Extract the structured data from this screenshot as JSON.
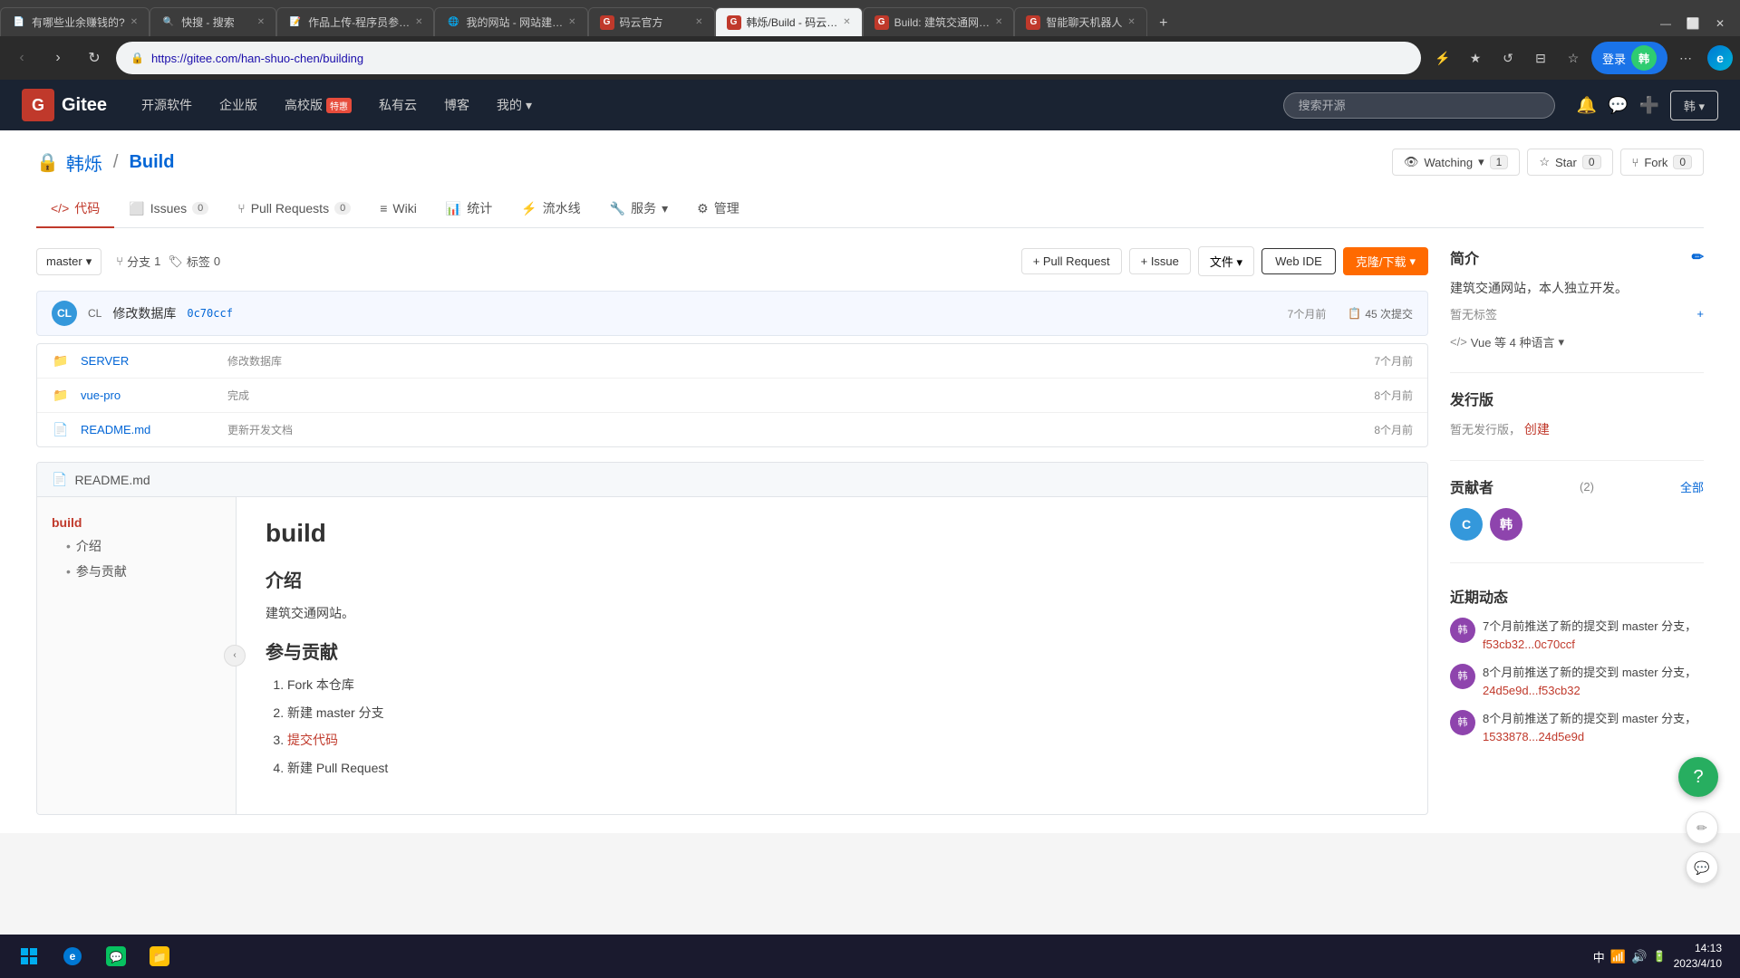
{
  "browser": {
    "address": "https://gitee.com/han-shuo-chen/building",
    "tabs": [
      {
        "id": "tab1",
        "title": "有哪些业余赚钱的?",
        "favicon": "📄",
        "active": false
      },
      {
        "id": "tab2",
        "title": "快搜 - 搜索",
        "favicon": "🔍",
        "active": false
      },
      {
        "id": "tab3",
        "title": "作品上传-程序员参…",
        "favicon": "📝",
        "active": false
      },
      {
        "id": "tab4",
        "title": "我的网站 - 网站建…",
        "favicon": "🌐",
        "active": false
      },
      {
        "id": "tab5",
        "title": "码云官方",
        "favicon": "G",
        "active": false
      },
      {
        "id": "tab6",
        "title": "韩烁/Build - 码云…",
        "favicon": "G",
        "active": true
      },
      {
        "id": "tab7",
        "title": "Build: 建筑交通网…",
        "favicon": "G",
        "active": false
      },
      {
        "id": "tab8",
        "title": "智能聊天机器人",
        "favicon": "G",
        "active": false
      }
    ]
  },
  "gitee": {
    "nav": {
      "logo_text": "Gitee",
      "items": [
        "开源软件",
        "企业版",
        "高校版",
        "私有云",
        "博客",
        "我的"
      ],
      "enterprise_badge": "特惠",
      "search_placeholder": "搜索开源"
    },
    "repo": {
      "owner": "韩烁",
      "slash": "/",
      "name": "Build",
      "lock_icon": "🔒",
      "watching_label": "Watching",
      "watching_count": "1",
      "star_label": "Star",
      "star_count": "0",
      "fork_label": "Fork",
      "fork_count": "0"
    },
    "tabs": [
      {
        "label": "代码",
        "icon": "</>",
        "active": true,
        "badge": ""
      },
      {
        "label": "Issues",
        "icon": "⬜",
        "active": false,
        "badge": "0"
      },
      {
        "label": "Pull Requests",
        "icon": "⑂",
        "active": false,
        "badge": "0"
      },
      {
        "label": "Wiki",
        "icon": "≡",
        "active": false,
        "badge": ""
      },
      {
        "label": "统计",
        "icon": "📊",
        "active": false,
        "badge": ""
      },
      {
        "label": "流水线",
        "icon": "⚡",
        "active": false,
        "badge": ""
      },
      {
        "label": "服务",
        "icon": "🔧",
        "active": false,
        "badge": ""
      },
      {
        "label": "管理",
        "icon": "⚙",
        "active": false,
        "badge": ""
      }
    ],
    "branch": {
      "name": "master",
      "branches_count": "1",
      "tags_count": "0",
      "branches_label": "分支",
      "tags_label": "标签"
    },
    "toolbar": {
      "pull_request_btn": "+ Pull Request",
      "issue_btn": "+ Issue",
      "file_btn": "文件",
      "webide_btn": "Web IDE",
      "clone_btn": "克隆/下载"
    },
    "commit": {
      "avatar_text": "CL",
      "label": "CL",
      "message": "修改数据库",
      "hash": "0c70ccf",
      "time": "7个月前",
      "count_icon": "📋",
      "count": "45 次提交"
    },
    "files": [
      {
        "icon": "📁",
        "name": "SERVER",
        "message": "修改数据库",
        "time": "7个月前",
        "type": "folder"
      },
      {
        "icon": "📁",
        "name": "vue-pro",
        "message": "完成",
        "time": "8个月前",
        "type": "folder"
      },
      {
        "icon": "📄",
        "name": "README.md",
        "message": "更新开发文档",
        "time": "8个月前",
        "type": "file"
      }
    ],
    "readme": {
      "header": "README.md",
      "toc": [
        {
          "level": 1,
          "text": "build"
        },
        {
          "level": 2,
          "text": "介绍"
        },
        {
          "level": 2,
          "text": "参与贡献"
        }
      ],
      "h1": "build",
      "sections": [
        {
          "heading": "介绍",
          "content": "建筑交通网站。"
        },
        {
          "heading": "参与贡献",
          "items": [
            "Fork 本仓库",
            "新建 master 分支",
            "提交代码",
            "新建 Pull Request"
          ]
        }
      ]
    },
    "sidebar": {
      "intro_title": "简介",
      "intro_desc": "建筑交通网站，本人独立开发。",
      "no_tags": "暂无标签",
      "lang": "Vue 等 4 种语言",
      "releases_title": "发行版",
      "releases_desc": "暂无发行版，",
      "releases_create": "创建",
      "contributors_title": "贡献者",
      "contributors_count": "(2)",
      "contributors_all": "全部",
      "contributors": [
        {
          "text": "C",
          "bg": "#3498db"
        },
        {
          "text": "韩",
          "bg": "#8e44ad"
        }
      ],
      "activity_title": "近期动态",
      "activities": [
        {
          "time": "7个月前推送了新的提交到 master 分支，",
          "link": "f53cb32...0c70ccf"
        },
        {
          "time": "8个月前推送了新的提交到 master 分支，",
          "link": "24d5e9d...f53cb32"
        },
        {
          "time": "8个月前推送了新的提交到 master 分支，",
          "link": "1533878...24d5e9d"
        }
      ]
    }
  },
  "taskbar": {
    "time": "14:13",
    "date": "2023/4/10",
    "input_method": "中"
  }
}
